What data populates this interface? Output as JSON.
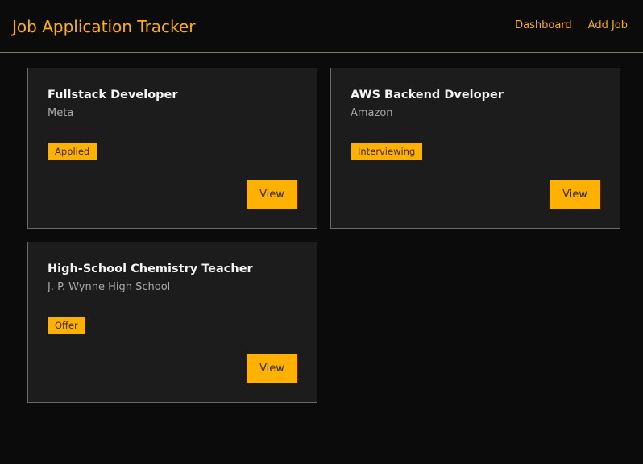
{
  "header": {
    "title": "Job Application Tracker",
    "nav": [
      {
        "label": "Dashboard"
      },
      {
        "label": "Add Job"
      }
    ]
  },
  "jobs": [
    {
      "title": "Fullstack Developer",
      "company": "Meta",
      "status": "Applied",
      "action_label": "View"
    },
    {
      "title": "AWS Backend Dveloper",
      "company": "Amazon",
      "status": "Interviewing",
      "action_label": "View"
    },
    {
      "title": "High-School Chemistry Teacher",
      "company": "J. P. Wynne High School",
      "status": "Offer",
      "action_label": "View"
    }
  ],
  "colors": {
    "accent": "#ffb100",
    "background": "#0b0b0b",
    "card_background": "#1c1c1c",
    "card_border": "#6a6a6a"
  }
}
